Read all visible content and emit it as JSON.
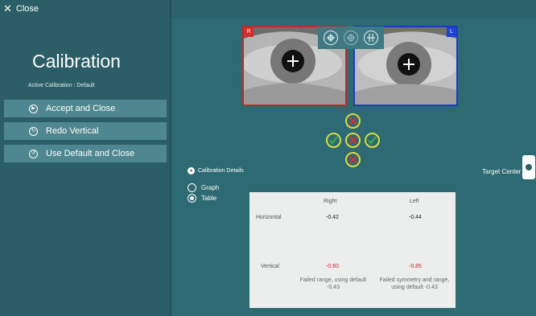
{
  "window": {
    "close_label": "Close",
    "close_icon": "close-icon"
  },
  "sidebar": {
    "title": "Calibration",
    "active_calibration": "Active Calibration : Default",
    "actions": [
      {
        "label": "Accept and Close",
        "icon": "play-icon"
      },
      {
        "label": "Redo Vertical",
        "icon": "redo-icon"
      },
      {
        "label": "Use Default and Close",
        "icon": "default-icon"
      }
    ]
  },
  "eyes": {
    "right": {
      "tag": "R",
      "border_color": "#c62828"
    },
    "left": {
      "tag": "L",
      "border_color": "#1b3bc7"
    }
  },
  "eye_toolbar": [
    "crosshair-icon",
    "target-icon",
    "center-icon"
  ],
  "targets": {
    "top": "fail",
    "left": "pass",
    "center": "fail",
    "right": "pass",
    "bottom": "fail",
    "colors": {
      "ring": "#d6dc3c",
      "pass": "#3fae49",
      "fail": "#d32f2f"
    }
  },
  "details": {
    "toggle_label": "Calibration Details",
    "view_options": [
      {
        "label": "Graph",
        "selected": false
      },
      {
        "label": "Table",
        "selected": true
      }
    ]
  },
  "table": {
    "columns": [
      "Right",
      "Left"
    ],
    "rows": [
      {
        "label": "Horizontal",
        "right": "-0.42",
        "left": "-0.44",
        "right_status": "ok",
        "left_status": "ok"
      },
      {
        "label": "Vertical",
        "right": "-0.60",
        "left": "-0.85",
        "right_status": "bad",
        "left_status": "bad",
        "right_note_1": "Failed range, using default",
        "right_note_2": "-0.43",
        "left_note_1": "Failed symmetry and range,",
        "left_note_2": "using default -0.43"
      }
    ]
  },
  "target_center": {
    "label": "Target Center"
  }
}
